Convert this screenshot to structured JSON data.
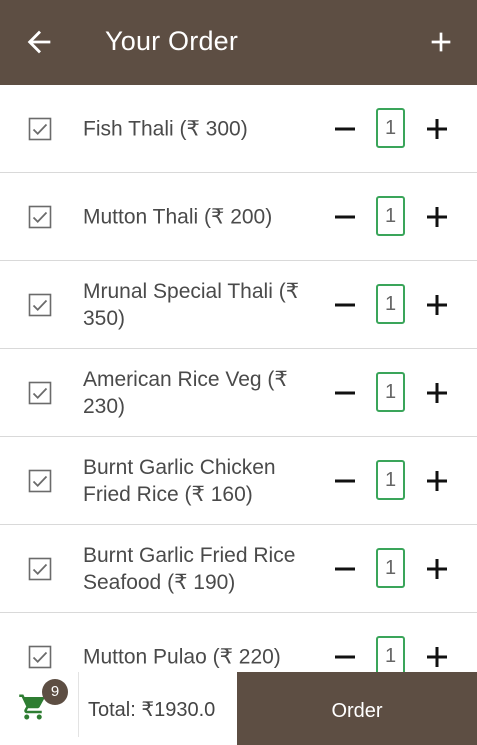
{
  "header": {
    "title": "Your Order",
    "back_icon": "arrow-left-icon",
    "add_icon": "plus-icon"
  },
  "items": [
    {
      "name": "Fish Thali (₹ 300)",
      "qty": "1",
      "checked": true
    },
    {
      "name": "Mutton Thali (₹ 200)",
      "qty": "1",
      "checked": true
    },
    {
      "name": "Mrunal Special Thali (₹ 350)",
      "qty": "1",
      "checked": true
    },
    {
      "name": "American Rice Veg (₹ 230)",
      "qty": "1",
      "checked": true
    },
    {
      "name": "Burnt Garlic Chicken Fried Rice (₹ 160)",
      "qty": "1",
      "checked": true
    },
    {
      "name": "Burnt Garlic Fried Rice Seafood (₹ 190)",
      "qty": "1",
      "checked": true
    },
    {
      "name": "Mutton Pulao (₹ 220)",
      "qty": "1",
      "checked": true
    }
  ],
  "footer": {
    "cart_count": "9",
    "total": "Total: ₹1930.0",
    "order_label": "Order"
  },
  "colors": {
    "primary": "#5d4e43",
    "accent_green": "#3aa55a",
    "cart_green": "#2e7d32"
  }
}
